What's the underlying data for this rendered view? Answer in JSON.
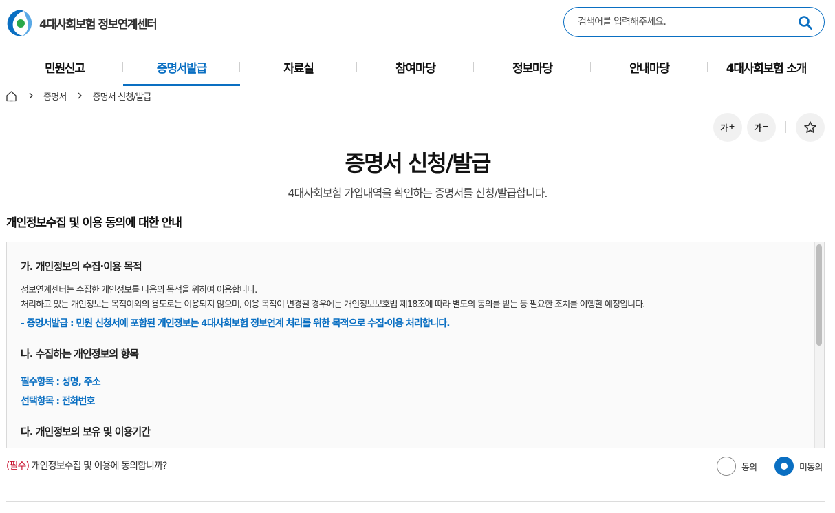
{
  "header": {
    "logo_text": "4대사회보험 정보연계센터",
    "search_placeholder": "검색어를 입력해주세요."
  },
  "nav": {
    "items": [
      {
        "label": "민원신고"
      },
      {
        "label": "증명서발급"
      },
      {
        "label": "자료실"
      },
      {
        "label": "참여마당"
      },
      {
        "label": "정보마당"
      },
      {
        "label": "안내마당"
      },
      {
        "label": "4대사회보험 소개"
      }
    ],
    "active_index": 1
  },
  "breadcrumb": {
    "home_icon": "home-icon",
    "items": [
      "증명서",
      "증명서 신청/발급"
    ]
  },
  "tools": {
    "font_up_label": "가",
    "font_up_sign": "+",
    "font_down_label": "가",
    "font_down_sign": "−",
    "bookmark_icon": "star-icon"
  },
  "page": {
    "title": "증명서 신청/발급",
    "subtitle": "4대사회보험 가입내역을 확인하는 증명서를 신청/발급합니다."
  },
  "privacy": {
    "section_title": "개인정보수집 및 이용 동의에 대한 안내",
    "a_title": "가. 개인정보의 수집·이용 목적",
    "a_line1": "정보연계센터는 수집한 개인정보를 다음의 목적을 위하여 이용합니다.",
    "a_line2": "처리하고 있는 개인정보는 목적이외의 용도로는 이용되지 않으며, 이용 목적이 변경될 경우에는 개인정보보호법 제18조에 따라 별도의 동의를 받는 등 필요한 조치를 이행할 예정입니다.",
    "a_highlight": "- 증명서발급 : 민원 신청서에 포함된 개인정보는 4대사회보험 정보연계 처리를 위한 목적으로 수집·이용 처리합니다.",
    "b_title": "나. 수집하는 개인정보의 항목",
    "b_required": "필수항목 : 성명, 주소",
    "b_optional": "선택항목 : 전화번호",
    "c_title": "다. 개인정보의 보유 및 이용기간"
  },
  "consent": {
    "required_tag": "(필수)",
    "question": " 개인정보수집 및 이용에 동의합니까?",
    "agree_label": "동의",
    "disagree_label": "미동의",
    "selected": "disagree"
  },
  "colors": {
    "accent": "#0a6fc2",
    "required": "#c8102e"
  }
}
